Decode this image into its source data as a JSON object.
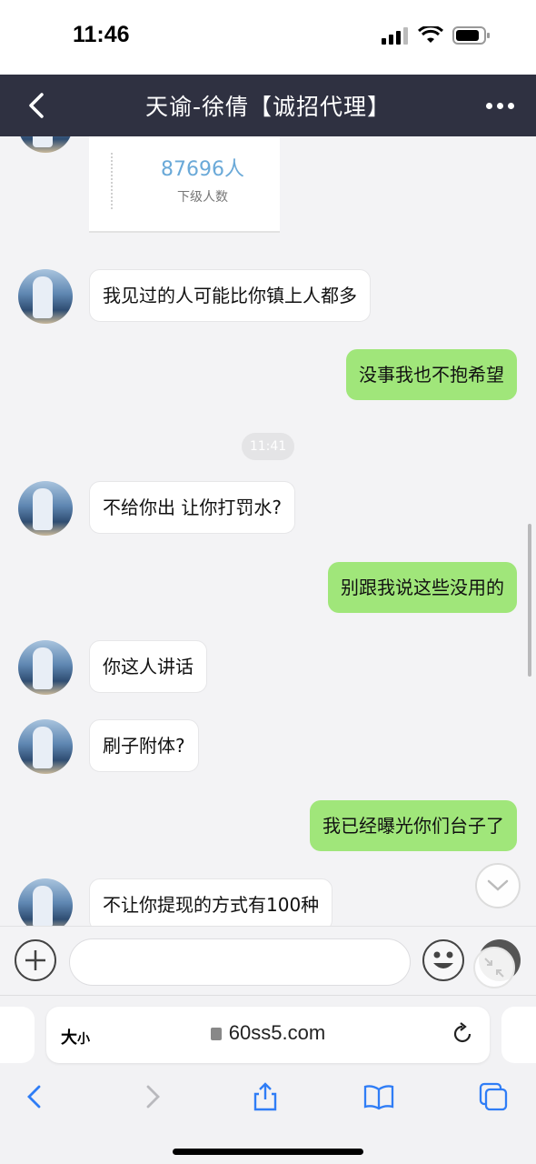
{
  "status_bar": {
    "time": "11:46"
  },
  "header": {
    "title": "天谕-徐倩【诚招代理】"
  },
  "card": {
    "value": "87696人",
    "label": "下级人数"
  },
  "messages": [
    {
      "side": "in",
      "text": "我见过的人可能比你镇上人都多"
    },
    {
      "side": "out",
      "text": "没事我也不抱希望"
    },
    {
      "side": "in",
      "text": "不给你出 让你打罚水?"
    },
    {
      "side": "out",
      "text": "别跟我说这些没用的"
    },
    {
      "side": "in",
      "text": "你这人讲话"
    },
    {
      "side": "in",
      "text": "刷子附体?"
    },
    {
      "side": "out",
      "text": "我已经曝光你们台子了"
    },
    {
      "side": "in",
      "text": "不让你提现的方式有100种"
    }
  ],
  "timestamp": "11:41",
  "browser": {
    "text_size_big": "大",
    "text_size_small": "小",
    "url": "60ss5.com"
  },
  "colors": {
    "nav_bg": "#2f3141",
    "outgoing_bubble": "#a0e67a",
    "incoming_bubble": "#ffffff",
    "link_blue": "#2f7df6"
  }
}
